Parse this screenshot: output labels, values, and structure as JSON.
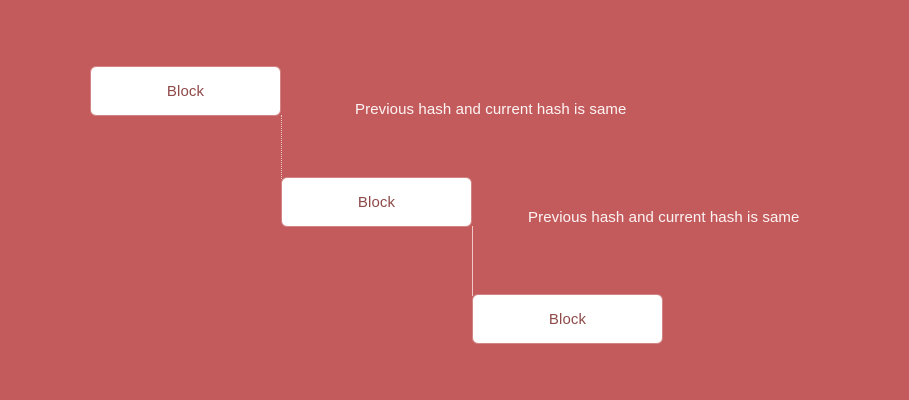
{
  "diagram": {
    "blocks": [
      {
        "label": "Block"
      },
      {
        "label": "Block"
      },
      {
        "label": "Block"
      }
    ],
    "notes": [
      {
        "text": "Previous hash and current hash is same"
      },
      {
        "text": "Previous hash and current hash is same"
      }
    ],
    "colors": {
      "background": "#c35b5c",
      "block_fill": "#ffffff",
      "block_text": "#8f4a4a",
      "note_text": "#fdf2f2"
    }
  }
}
